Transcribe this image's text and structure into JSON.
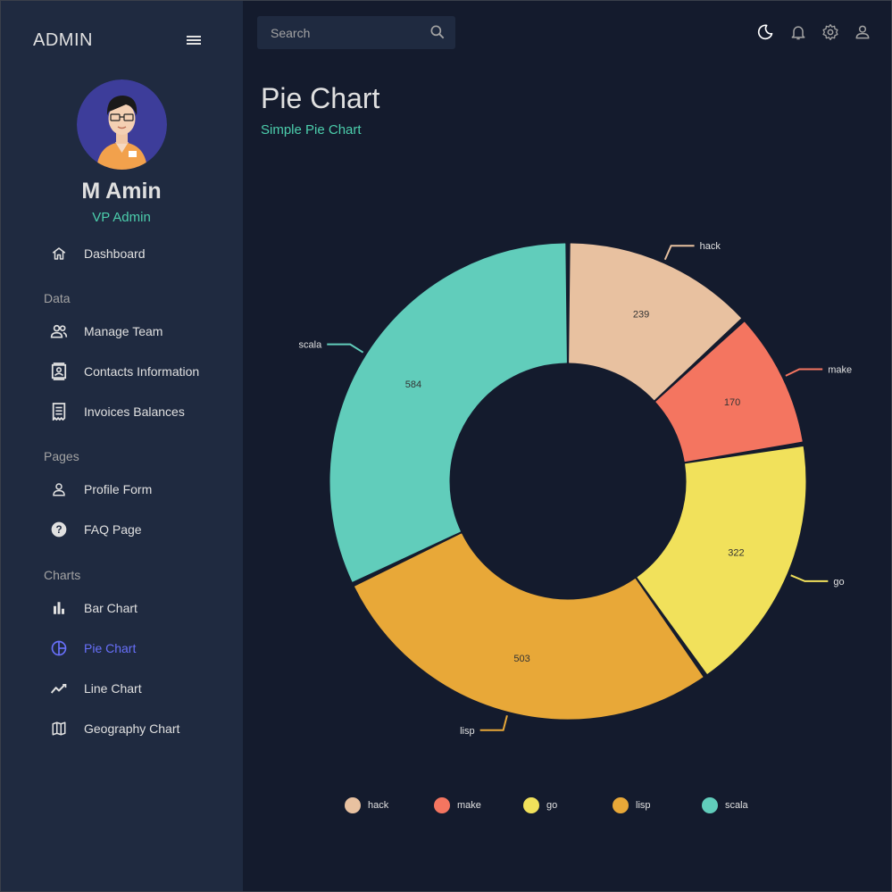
{
  "sidebar": {
    "brand": "ADMIN",
    "user": {
      "name": "M Amin",
      "role": "VP Admin"
    },
    "sections": {
      "data": "Data",
      "pages": "Pages",
      "charts": "Charts"
    },
    "items": [
      {
        "label": "Dashboard",
        "icon": "home-icon"
      },
      {
        "label": "Manage Team",
        "icon": "people-icon"
      },
      {
        "label": "Contacts Information",
        "icon": "contacts-icon"
      },
      {
        "label": "Invoices Balances",
        "icon": "receipt-icon"
      },
      {
        "label": "Profile Form",
        "icon": "person-icon"
      },
      {
        "label": "FAQ Page",
        "icon": "help-icon"
      },
      {
        "label": "Bar Chart",
        "icon": "bar-chart-icon"
      },
      {
        "label": "Pie Chart",
        "icon": "pie-chart-icon",
        "active": true
      },
      {
        "label": "Line Chart",
        "icon": "line-chart-icon"
      },
      {
        "label": "Geography Chart",
        "icon": "map-icon"
      }
    ]
  },
  "topbar": {
    "search": {
      "placeholder": "Search",
      "value": ""
    },
    "icons": [
      "dark-mode-icon",
      "notifications-icon",
      "settings-icon",
      "profile-icon"
    ]
  },
  "header": {
    "title": "Pie Chart",
    "subtitle": "Simple Pie Chart"
  },
  "colors": {
    "background": "#141b2d",
    "sidebar": "#1f2a40",
    "accent_green": "#4cceac",
    "accent_active": "#6870fa"
  },
  "chart_data": {
    "type": "pie",
    "donut": true,
    "categories": [
      "hack",
      "make",
      "go",
      "lisp",
      "scala"
    ],
    "values": [
      239,
      170,
      322,
      503,
      584
    ],
    "colors": [
      "#e8c1a0",
      "#f47560",
      "#f1e15b",
      "#e8a838",
      "#61cdbb"
    ],
    "legend": "bottom"
  }
}
